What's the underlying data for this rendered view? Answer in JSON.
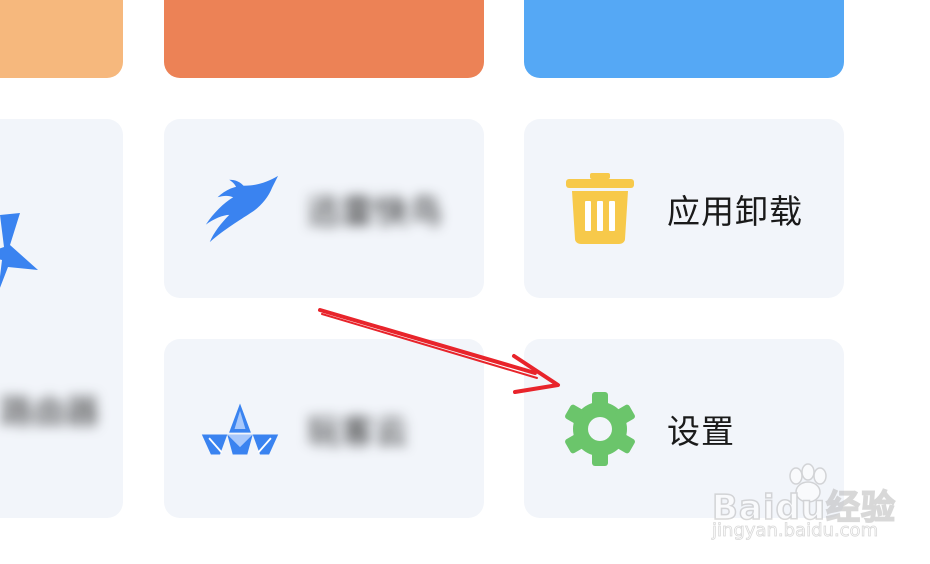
{
  "grid": {
    "cards": [
      {
        "id": "xunlei",
        "label": "迅雷快鸟",
        "icon": "swallow-bird-icon",
        "label_blurred": true
      },
      {
        "id": "uninstall",
        "label": "应用卸载",
        "icon": "trash-can-icon",
        "label_blurred": false
      },
      {
        "id": "cloud",
        "label": "玩客云",
        "icon": "paper-boat-icon",
        "label_blurred": true
      },
      {
        "id": "settings",
        "label": "设置",
        "icon": "gear-icon",
        "label_blurred": false
      }
    ],
    "left_card": {
      "label": "路由器",
      "icon": "lightning-star-icon",
      "label_blurred": true
    }
  },
  "colors": {
    "tile_orange_light": "#f6b87d",
    "tile_orange": "#ec8256",
    "tile_blue": "#55a8f5",
    "card_bg": "#f2f5fa",
    "trash_yellow": "#f7c94a",
    "gear_green": "#6bc56b",
    "icon_blue": "#3a83f0",
    "arrow_red": "#e8242b"
  },
  "watermark": {
    "main": "Baidu经验",
    "sub": "jingyan.baidu.com"
  }
}
